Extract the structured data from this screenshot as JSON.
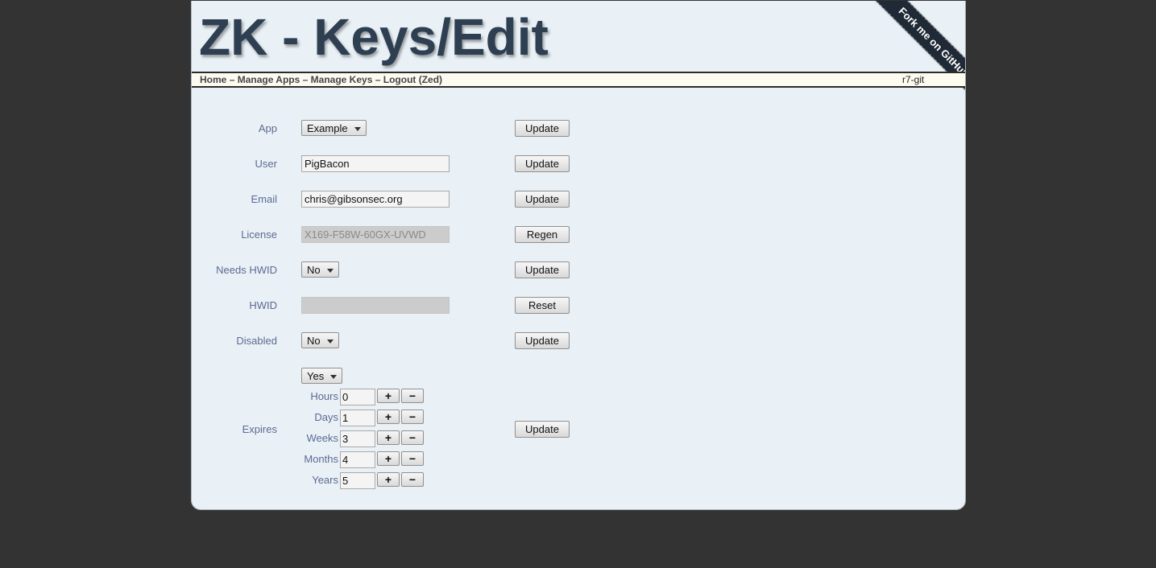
{
  "header": {
    "title": "ZK - Keys/Edit",
    "version": "r7-git",
    "ribbon": "Fork me on GitHub"
  },
  "nav": {
    "home": "Home",
    "sep": "–",
    "apps": "Manage Apps",
    "keys": "Manage Keys",
    "logout": "Logout (Zed)"
  },
  "form": {
    "app": {
      "label": "App",
      "value": "Example",
      "button": "Update"
    },
    "user": {
      "label": "User",
      "value": "PigBacon",
      "button": "Update"
    },
    "email": {
      "label": "Email",
      "value": "chris@gibsonsec.org",
      "button": "Update"
    },
    "license": {
      "label": "License",
      "value": "X169-F58W-60GX-UVWD",
      "button": "Regen"
    },
    "needs_hwid": {
      "label": "Needs HWID",
      "value": "No",
      "button": "Update"
    },
    "hwid": {
      "label": "HWID",
      "value": "",
      "button": "Reset"
    },
    "disabled": {
      "label": "Disabled",
      "value": "No",
      "button": "Update"
    },
    "expires": {
      "label": "Expires",
      "value": "Yes",
      "button": "Update",
      "plus": "+",
      "minus": "−",
      "hours": {
        "label": "Hours",
        "value": "0"
      },
      "days": {
        "label": "Days",
        "value": "1"
      },
      "weeks": {
        "label": "Weeks",
        "value": "3"
      },
      "months": {
        "label": "Months",
        "value": "4"
      },
      "years": {
        "label": "Years",
        "value": "5"
      }
    }
  }
}
